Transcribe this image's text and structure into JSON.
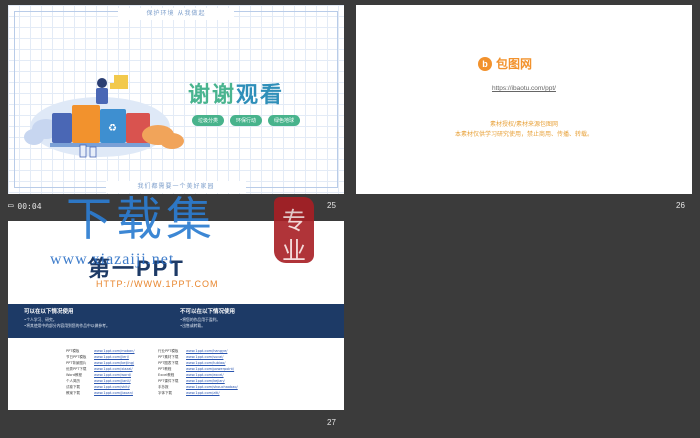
{
  "slide25": {
    "number": "25",
    "top_tag": "保护环境 从我做起",
    "title_part1": "谢谢",
    "title_part2": "观看",
    "pills": [
      "垃圾分类",
      "环保行动",
      "绿色地球"
    ],
    "bottom_tag": "我们都需要一个美好家园"
  },
  "slide26": {
    "number": "26",
    "logo_mark": "b",
    "logo_text": "包图网",
    "url": "https://ibaotu.com/ppt/",
    "note_line1": "素材授权/素材来源包图网",
    "note_line2": "本素材仅供学习研究使用，禁止商用、传播、转载。"
  },
  "slide27": {
    "number": "27",
    "brand": "第一PPT",
    "brand_url": "HTTP://WWW.1PPT.COM",
    "left_heading": "可以在以下情况使用",
    "left_items": [
      "•个人学习、研究。",
      "•将其使用中的部分内容用到您的作品中以做参考。"
    ],
    "right_heading": "不可以在以下情况使用",
    "right_items": [
      "•将您的作品用于盈利。",
      "•出售或转载。"
    ],
    "links_left": [
      {
        "k": "PPT模板",
        "v": "www.1ppt.com/moban/"
      },
      {
        "k": "节日PPT模板",
        "v": "www.1ppt.com/jieri/"
      },
      {
        "k": "PPT背景图片",
        "v": "www.1ppt.com/beijing/"
      },
      {
        "k": "优秀PPT下载",
        "v": "www.1ppt.com/xiazai/"
      },
      {
        "k": "Word教程",
        "v": "www.1ppt.com/word/"
      },
      {
        "k": "个人简历",
        "v": "www.1ppt.com/jianli/"
      },
      {
        "k": "试卷下载",
        "v": "www.1ppt.com/shiti/"
      },
      {
        "k": "教案下载",
        "v": "www.1ppt.com/jiaoan/"
      }
    ],
    "links_right": [
      {
        "k": "行业PPT模板",
        "v": "www.1ppt.com/hangye/"
      },
      {
        "k": "PPT素材下载",
        "v": "www.1ppt.com/sucai/"
      },
      {
        "k": "PPT图表下载",
        "v": "www.1ppt.com/tubiao/"
      },
      {
        "k": "PPT教程",
        "v": "www.1ppt.com/powerpoint/"
      },
      {
        "k": "Excel教程",
        "v": "www.1ppt.com/excel/"
      },
      {
        "k": "PPT课件下载",
        "v": "www.1ppt.com/kejian/"
      },
      {
        "k": "手抄报",
        "v": "www.1ppt.com/shouchaobao/"
      },
      {
        "k": "字体下载",
        "v": "www.1ppt.com/ziti/"
      }
    ]
  },
  "timer": "00:04",
  "watermark": {
    "big": "下载集",
    "site": "www.xiazaiji.net",
    "seal_top": "专",
    "seal_bottom": "业"
  }
}
